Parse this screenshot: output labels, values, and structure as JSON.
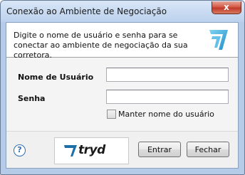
{
  "window": {
    "title": "Conexão ao Ambiente de Negociação",
    "close_glyph": "x"
  },
  "header": {
    "message": "Digite o nome de usuário e senha para se conectar ao ambiente de negociação da sua corretora.",
    "icon": "tryd-arrow-icon"
  },
  "form": {
    "username_label": "Nome de Usuário",
    "username_value": "",
    "password_label": "Senha",
    "password_value": "",
    "remember_label": "Manter nome do usuário",
    "remember_checked": false
  },
  "footer": {
    "help_glyph": "?",
    "logo_text": "tryd",
    "connect_label": "Entrar",
    "close_label": "Fechar"
  },
  "colors": {
    "accent": "#2f6fb2",
    "close_button": "#c0392b",
    "frame": "#b5cbe8"
  }
}
